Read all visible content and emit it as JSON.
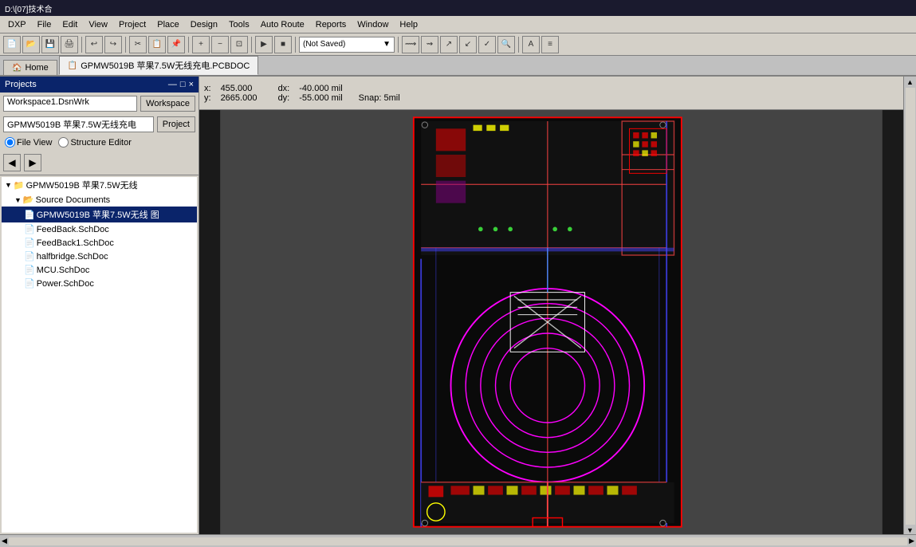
{
  "title_bar": {
    "text": "D:\\[07]技术合"
  },
  "menu": {
    "items": [
      "DXP",
      "File",
      "Edit",
      "View",
      "Project",
      "Place",
      "Design",
      "Tools",
      "Auto Route",
      "Reports",
      "Window",
      "Help"
    ]
  },
  "toolbar": {
    "file_status": "(Not Saved)",
    "coord_label": "▼"
  },
  "tabs": [
    {
      "label": "Home",
      "icon": "🏠",
      "active": false
    },
    {
      "label": "GPMW5019B 苹果7.5W无线充电.PCBDOC",
      "icon": "📋",
      "active": true
    }
  ],
  "panel": {
    "title": "Projects",
    "minimize_label": "—",
    "close_label": "×",
    "workspace_value": "Workspace1.DsnWrk",
    "workspace_btn": "Workspace",
    "project_value": "GPMW5019B 苹果7.5W无线充电",
    "project_btn": "Project",
    "radio_file_view": "File View",
    "radio_structure": "Structure Editor"
  },
  "coords": {
    "x_label": "x:",
    "x_value": "455.000",
    "dx_label": "dx:",
    "dx_value": "-40.000 mil",
    "y_label": "y:",
    "y_value": "2665.000",
    "dy_label": "dy:",
    "dy_value": "-55.000 mil",
    "snap_label": "Snap: 5mil"
  },
  "tree": {
    "root": {
      "label": "GPMW5019B 苹果7.5W无线",
      "icon": "📁",
      "children": [
        {
          "label": "Source Documents",
          "icon": "📂",
          "children": [
            {
              "label": "GPMW5019B 苹果7.5W无线 图",
              "icon": "📄",
              "selected": true
            },
            {
              "label": "FeedBack.SchDoc",
              "icon": "📄",
              "selected": false
            },
            {
              "label": "FeedBack1.SchDoc",
              "icon": "📄",
              "selected": false
            },
            {
              "label": "halfbridge.SchDoc",
              "icon": "📄",
              "selected": false
            },
            {
              "label": "MCU.SchDoc",
              "icon": "📄",
              "selected": false
            },
            {
              "label": "Power.SchDoc",
              "icon": "📄",
              "selected": false
            }
          ]
        }
      ]
    }
  }
}
